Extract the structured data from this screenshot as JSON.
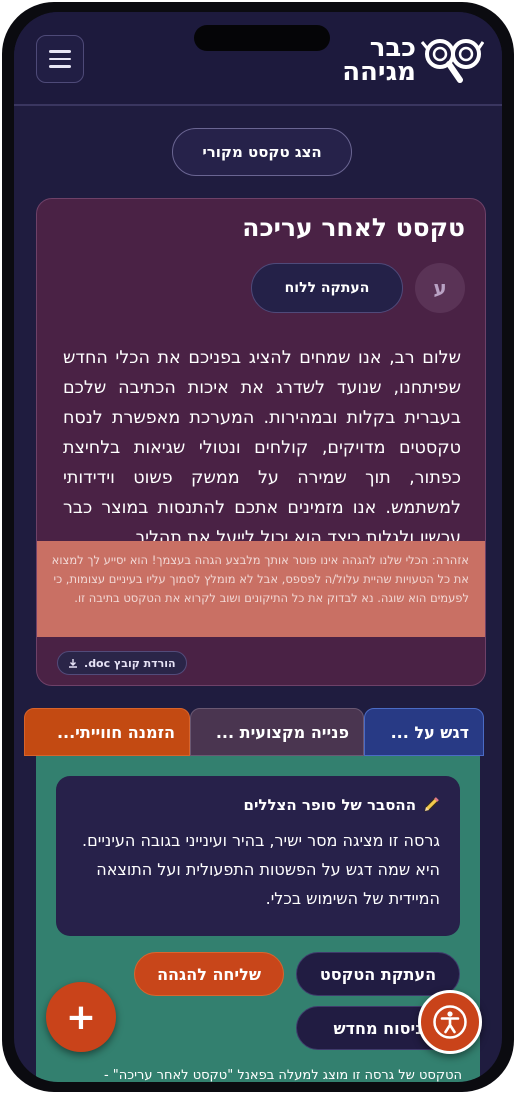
{
  "header": {
    "logo_line1": "כבר",
    "logo_line2": "מגיהה",
    "menu_icon": "hamburger-icon"
  },
  "show_original_label": "הצג טקסט מקורי",
  "edited": {
    "title": "טקסט לאחר עריכה",
    "copy_label": "העתקה ללוח",
    "font_toggle_glyph": "ע",
    "body": "שלום רב, אנו שמחים להציג בפניכם את הכלי החדש שפיתחנו, שנועד לשדרג את איכות הכתיבה שלכם בעברית בקלות ובמהירות. המערכת מאפשרת לנסח טקסטים מדויקים, קולחים ונטולי שגיאות בלחיצת כפתור, תוך שמירה על ממשק פשוט וידידותי למשתמש. אנו מזמינים אתכם להתנסות במוצר כבר עכשיו ולגלות כיצד הוא יכול לייעל את תהליך",
    "warning": "אזהרה: הכלי שלנו להגהה אינו פוטר אותך מלבצע הגהה בעצמך! הוא יסייע לך למצוא את כל הטעויות שהיית עלול/ה לפספס, אבל לא מומלץ לסמוך עליו בעיניים עצומות, כי לפעמים הוא שוגה. נא לבדוק את כל התיקונים ושוב לקרוא את הטקסט בתיבה זו.",
    "download_label": "הורדת קובץ doc."
  },
  "tabs": [
    {
      "label": "דגש על ..."
    },
    {
      "label": "פנייה מקצועית ..."
    },
    {
      "label": "הזמנה חווייתי..."
    }
  ],
  "panel": {
    "explain_title": "ההסבר של סופר הצללים",
    "explain_body": "גרסה זו מציגה מסר ישיר, בהיר ועינייני בגובה העיניים. היא שמה דגש על הפשטות התפעולית ועל התוצאה המיידית של השימוש בכלי.",
    "copy_text_label": "העתקת הטקסט",
    "send_check_label": "שליחה להגהה",
    "retry_label": "ניסוח מחדש",
    "footer_text": "הטקסט של גרסה זו מוצג למעלה בפאנל \"טקסט לאחר עריכה\" -"
  },
  "fab_add_label": "+",
  "colors": {
    "background": "#1f1c3f",
    "edited_card": "#4a2245",
    "warning": "#c97064",
    "panel": "#33806f",
    "accent_orange": "#c9431a",
    "tab_blue": "#283a85"
  }
}
